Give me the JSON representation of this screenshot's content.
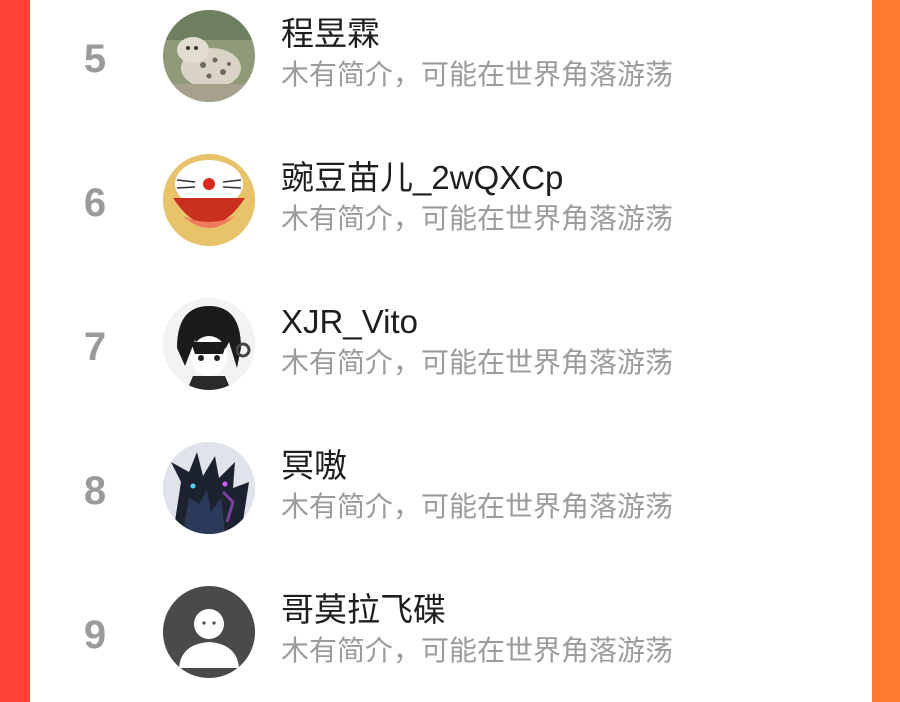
{
  "leaderboard": {
    "items": [
      {
        "rank": "5",
        "name": "程昱霖",
        "bio": "木有简介，可能在世界角落游荡",
        "avatar_icon": "snow-leopard-avatar-icon"
      },
      {
        "rank": "6",
        "name": "豌豆苗儿_2wQXCp",
        "bio": "木有简介，可能在世界角落游荡",
        "avatar_icon": "doraemon-avatar-icon"
      },
      {
        "rank": "7",
        "name": "XJR_Vito",
        "bio": "木有简介，可能在世界角落游荡",
        "avatar_icon": "anime-boy-avatar-icon"
      },
      {
        "rank": "8",
        "name": "冥嗷",
        "bio": "木有简介，可能在世界角落游荡",
        "avatar_icon": "dark-monster-avatar-icon"
      },
      {
        "rank": "9",
        "name": "哥莫拉飞碟",
        "bio": "木有简介，可能在世界角落游荡",
        "avatar_icon": "default-user-avatar-icon"
      }
    ]
  },
  "colors": {
    "background_left": "#ff4236",
    "background_right": "#ff7a2e",
    "rank_gray": "#9a9a9a",
    "name_text": "#1e1e1e",
    "bio_text": "#9b9b9b"
  }
}
